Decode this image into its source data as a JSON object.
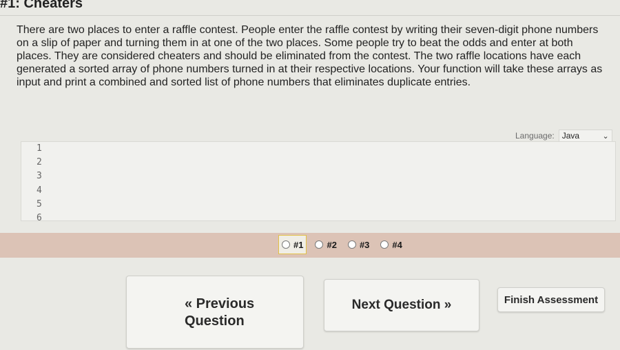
{
  "question": {
    "title": "#1: Cheaters",
    "prompt": "There are two places to enter a raffle contest. People enter the raffle contest by writing their seven-digit phone numbers on a slip of paper and turning them in at one of the two places. Some people try to beat the odds and enter at both places. They are considered cheaters and should be eliminated from the contest. The two raffle locations have each generated a sorted array of phone numbers turned in at their respective locations. Your function will take these arrays as input and print a combined and sorted list of phone numbers that eliminates duplicate entries."
  },
  "editor": {
    "language_label": "Language:",
    "language_value": "Java",
    "line_numbers": [
      "1",
      "2",
      "3",
      "4",
      "5",
      "6"
    ]
  },
  "question_nav": {
    "items": [
      {
        "label": "#1",
        "current": true
      },
      {
        "label": "#2",
        "current": false
      },
      {
        "label": "#3",
        "current": false
      },
      {
        "label": "#4",
        "current": false
      }
    ]
  },
  "buttons": {
    "previous": "« Previous Question",
    "next": "Next Question »",
    "finish": "Finish Assessment"
  }
}
